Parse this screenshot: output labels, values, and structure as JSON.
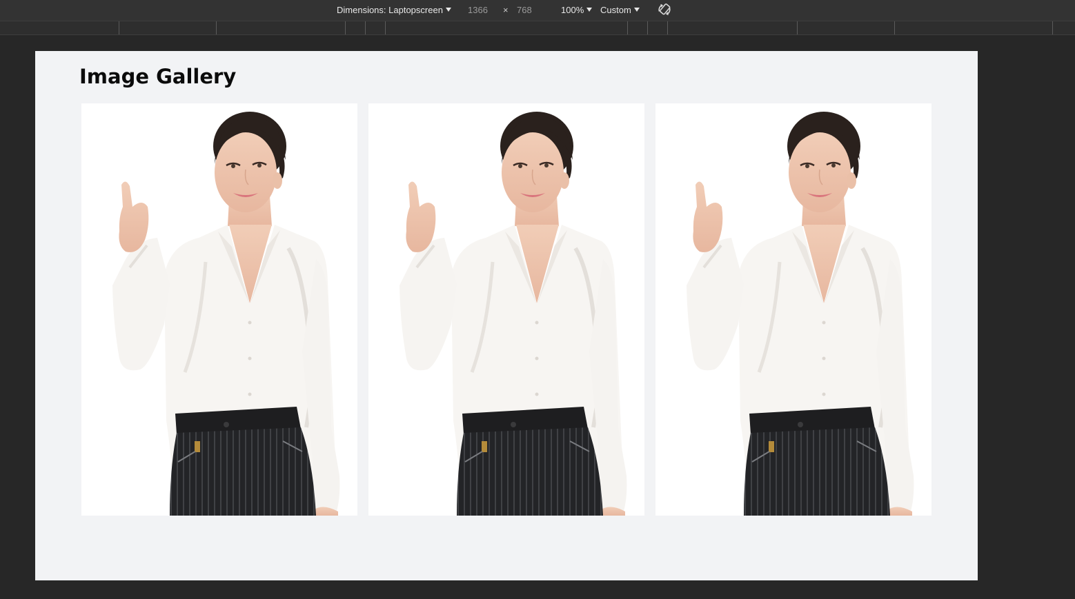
{
  "toolbar": {
    "dimensions_label": "Dimensions: Laptopscreen",
    "width": "1366",
    "times": "×",
    "height": "768",
    "zoom": "100%",
    "throttle": "Custom",
    "rotate_icon": "rotate-icon"
  },
  "page": {
    "title": "Image Gallery",
    "gallery": [
      {
        "image": "woman-pointing-photo"
      },
      {
        "image": "woman-pointing-photo"
      },
      {
        "image": "woman-pointing-photo"
      }
    ]
  },
  "colors": {
    "devtools_bg": "#272727",
    "toolbar_bg": "#333333",
    "page_bg": "#f2f3f5"
  }
}
